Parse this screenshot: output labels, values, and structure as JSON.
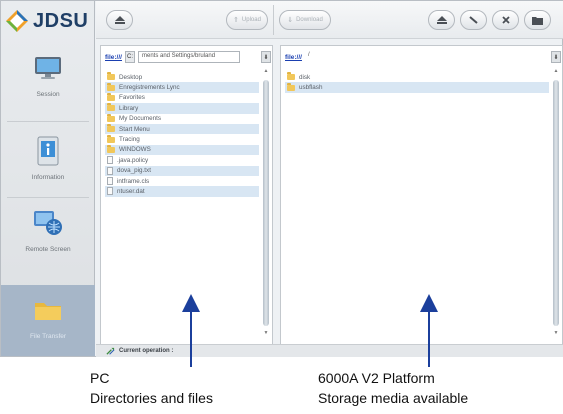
{
  "app": {
    "logo_text": "JDSU"
  },
  "sidebar": {
    "items": [
      {
        "label": "Session",
        "icon": "monitor-icon"
      },
      {
        "label": "Information",
        "icon": "info-icon"
      },
      {
        "label": "Remote Screen",
        "icon": "remote-screen-icon"
      },
      {
        "label": "File Transfer",
        "icon": "folder-icon",
        "active": true
      }
    ]
  },
  "toolbar": {
    "upload_label": "Upload",
    "download_label": "Download",
    "left_home_icon": "eject-icon",
    "right_icons": [
      "eject-icon",
      "edit-icon",
      "delete-icon",
      "new-folder-icon"
    ]
  },
  "left_panel": {
    "path_root": "file:///",
    "path_button": "C:",
    "path_value": "ments and Settings/bruland",
    "files": [
      {
        "name": "Desktop",
        "type": "folder"
      },
      {
        "name": "Enregistrements Lync",
        "type": "folder"
      },
      {
        "name": "Favorites",
        "type": "folder"
      },
      {
        "name": "Library",
        "type": "folder"
      },
      {
        "name": "My Documents",
        "type": "folder"
      },
      {
        "name": "Start Menu",
        "type": "folder"
      },
      {
        "name": "Tracing",
        "type": "folder"
      },
      {
        "name": "WINDOWS",
        "type": "folder"
      },
      {
        "name": ".java.policy",
        "type": "file"
      },
      {
        "name": "dova_pig.txt",
        "type": "file"
      },
      {
        "name": "intframe.cls",
        "type": "file"
      },
      {
        "name": "ntuser.dat",
        "type": "file"
      }
    ]
  },
  "right_panel": {
    "path_root": "file:///",
    "path_value": "/",
    "files": [
      {
        "name": "disk",
        "type": "folder"
      },
      {
        "name": "usbflash",
        "type": "folder"
      }
    ]
  },
  "status": {
    "text": "Current operation :"
  },
  "annotations": {
    "left_line1": "PC",
    "left_line2": "Directories and files",
    "right_line1": "6000A V2 Platform",
    "right_line2": "Storage media available"
  },
  "colors": {
    "brand": "#1f3f66",
    "accent_arrow": "#1b3f9c",
    "selection_row": "#d8e6f3",
    "active_nav": "#a6b6c8"
  }
}
